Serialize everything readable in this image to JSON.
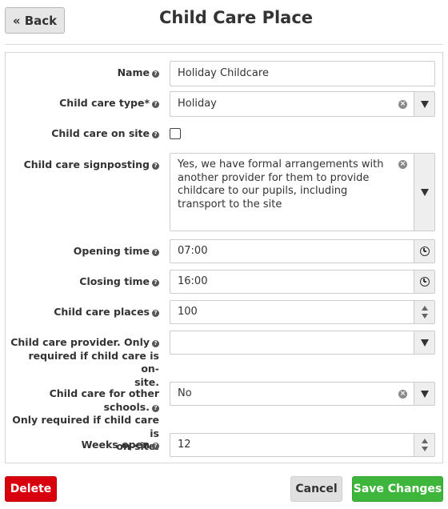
{
  "header": {
    "back_label": "« Back",
    "title": "Child Care Place"
  },
  "form": {
    "help_glyph": "?",
    "name": {
      "label": "Name",
      "value": "Holiday Childcare"
    },
    "type": {
      "label": "Child care type*",
      "value": "Holiday"
    },
    "on_site": {
      "label": "Child care on site",
      "checked": false
    },
    "signposting": {
      "label": "Child care signposting",
      "value": "Yes, we have formal arrangements with another provider for them to provide childcare to our pupils, including transport to the site"
    },
    "opening_time": {
      "label": "Opening time",
      "value": "07:00"
    },
    "closing_time": {
      "label": "Closing time",
      "value": "16:00"
    },
    "places": {
      "label": "Child care places",
      "value": "100"
    },
    "provider": {
      "label_line1": "Child care provider. Only",
      "label_line2": "required if child care is on-",
      "label_line3": "site.",
      "value": ""
    },
    "other_schools": {
      "label_line1": "Child care for other schools.",
      "label_line2": "Only required if child care is",
      "label_line3": "on-site.",
      "value": "No"
    },
    "weeks_open": {
      "label": "Weeks open",
      "value": "12"
    }
  },
  "buttons": {
    "delete": "Delete",
    "cancel": "Cancel",
    "save": "Save Changes"
  },
  "colors": {
    "delete": "#d9000d",
    "save": "#3eb53b",
    "cancel": "#e0e0e0"
  }
}
